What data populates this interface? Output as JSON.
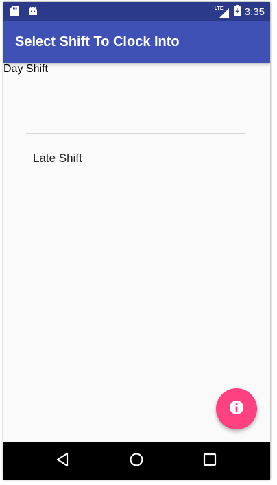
{
  "status_bar": {
    "time": "3:35",
    "network_label": "LTE",
    "left_icons": [
      "sd-card-icon",
      "android-icon"
    ],
    "right_icons": [
      "signal-icon",
      "battery-charging-icon"
    ]
  },
  "app_bar": {
    "title": "Select Shift To Clock Into",
    "color": "#3f51b5"
  },
  "shifts": {
    "items": [
      {
        "label": "Day Shift"
      },
      {
        "label": "Late Shift"
      }
    ]
  },
  "fab": {
    "icon": "info-icon",
    "color": "#ff4081"
  },
  "nav_bar": {
    "buttons": [
      "back-icon",
      "home-icon",
      "recents-icon"
    ]
  }
}
